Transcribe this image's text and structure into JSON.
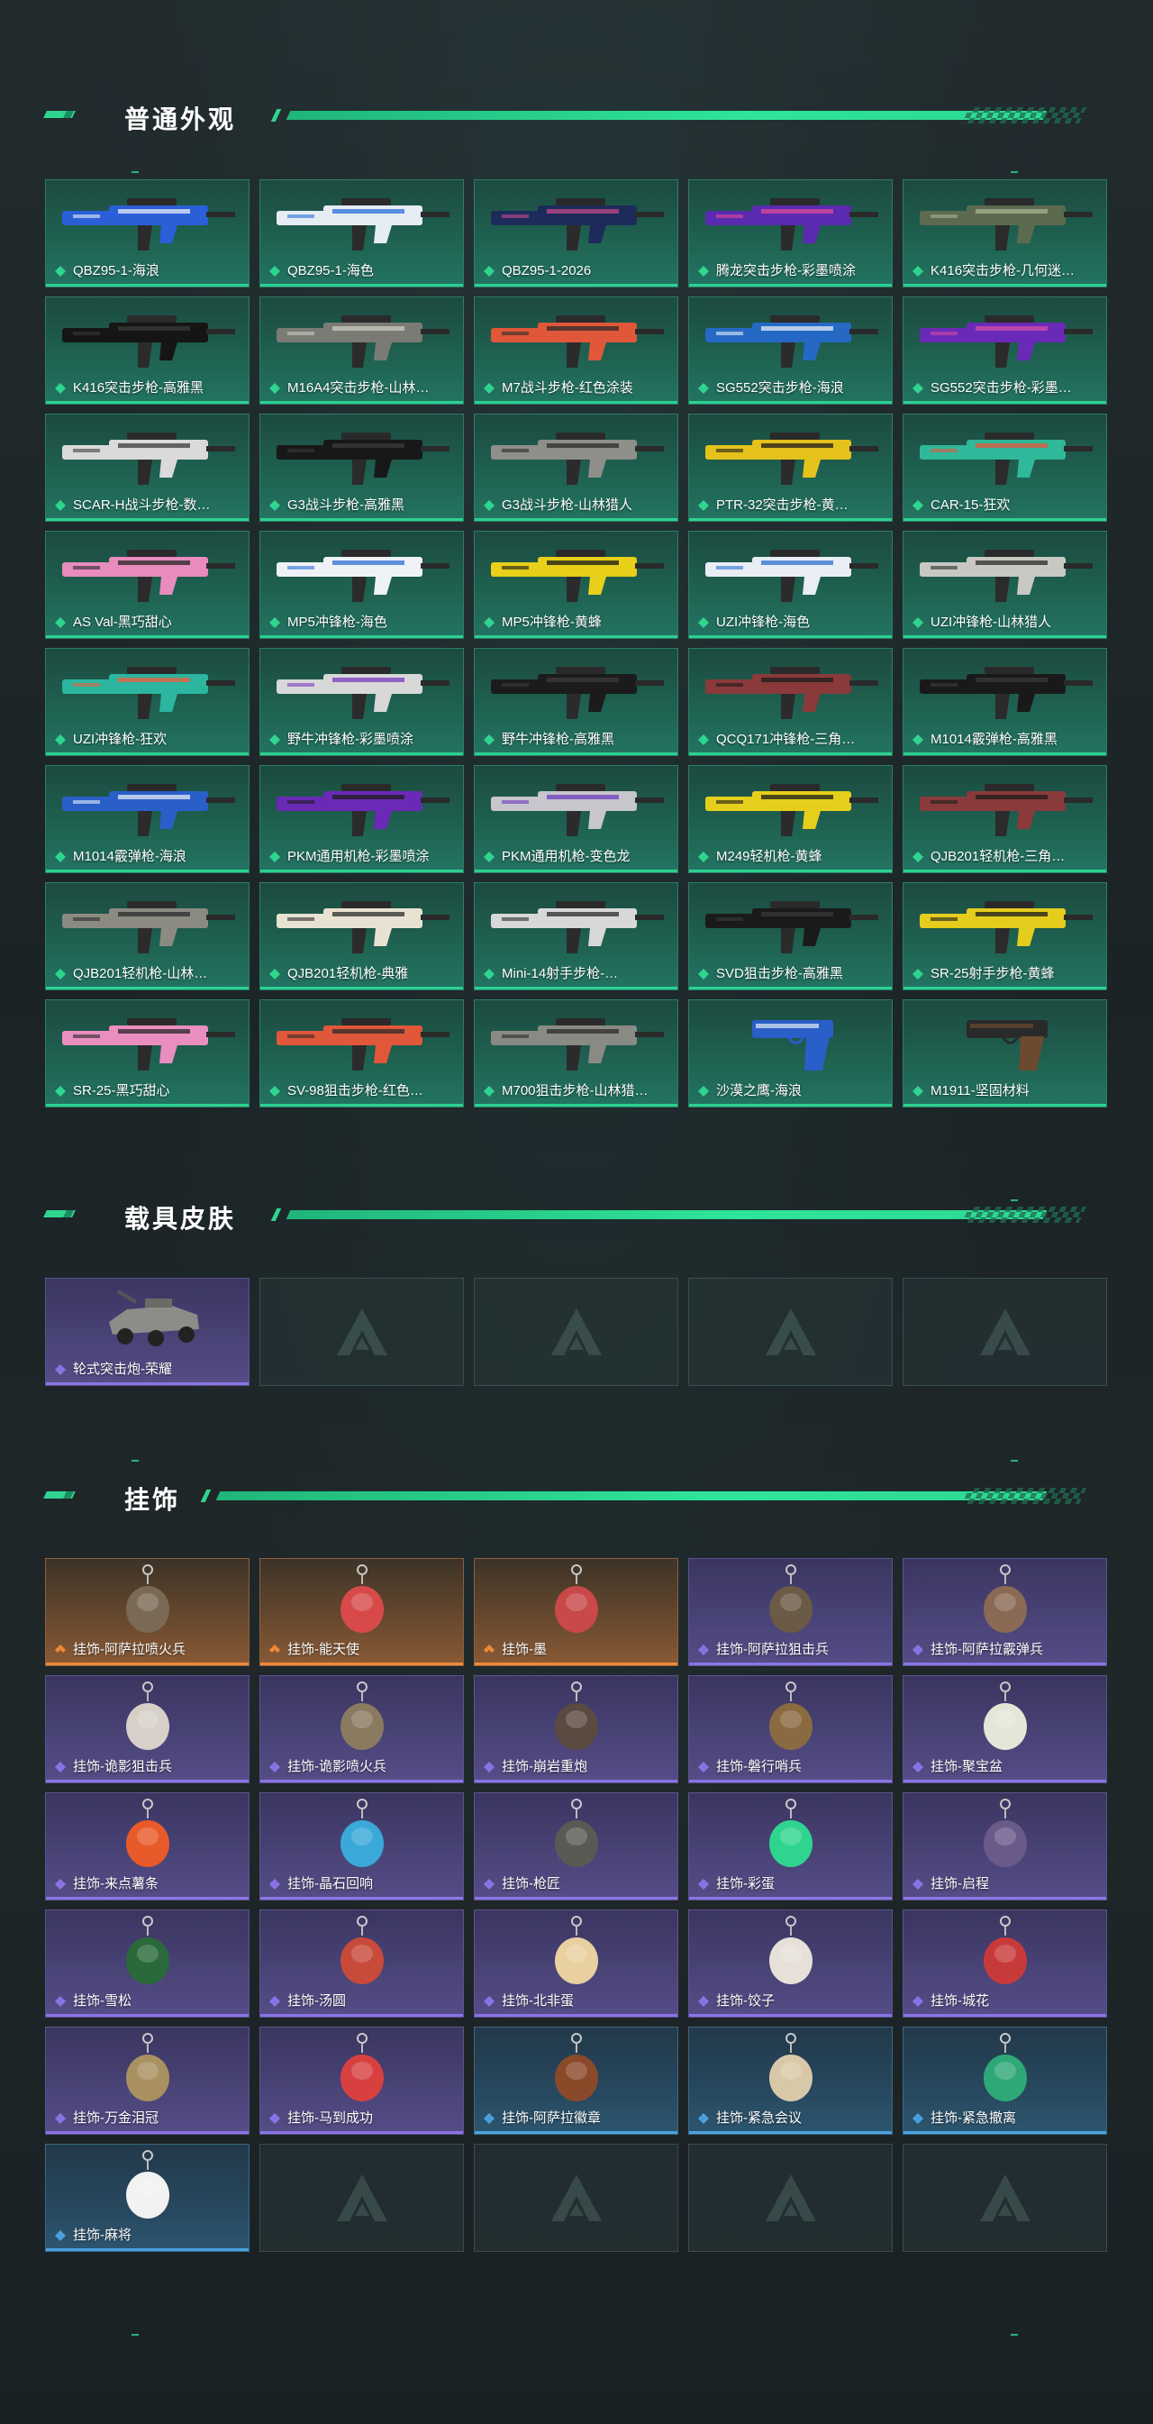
{
  "sections": {
    "weapons": {
      "title": "普通外观",
      "items": [
        {
          "label": "QBZ95-1-海浪",
          "color": "#2a5fd8",
          "accent": "#e9eef5"
        },
        {
          "label": "QBZ95-1-海色",
          "color": "#e6ecf3",
          "accent": "#2a6fd8"
        },
        {
          "label": "QBZ95-1-2026",
          "color": "#1d2b5a",
          "accent": "#c24b8a"
        },
        {
          "label": "腾龙突击步枪-彩墨喷涂",
          "color": "#5a2ab0",
          "accent": "#e04c9a"
        },
        {
          "label": "K416突击步枪-几何迷…",
          "color": "#5c6a50",
          "accent": "#a9b38e"
        },
        {
          "label": "K416突击步枪-高雅黑",
          "color": "#151515",
          "accent": "#3a3a3a"
        },
        {
          "label": "M16A4突击步枪-山林…",
          "color": "#7b7b76",
          "accent": "#c9c9c2"
        },
        {
          "label": "M7战斗步枪-红色涂装",
          "color": "#e0573a",
          "accent": "#2b2b2b"
        },
        {
          "label": "SG552突击步枪-海浪",
          "color": "#2569c4",
          "accent": "#e3eef8"
        },
        {
          "label": "SG552突击步枪-彩墨…",
          "color": "#6a2ab8",
          "accent": "#d54fa8"
        },
        {
          "label": "SCAR-H战斗步枪-数…",
          "color": "#dadada",
          "accent": "#3a3a3a"
        },
        {
          "label": "G3战斗步枪-高雅黑",
          "color": "#181818",
          "accent": "#3b3b3b"
        },
        {
          "label": "G3战斗步枪-山林猎人",
          "color": "#8e8e8a",
          "accent": "#2a2a2a"
        },
        {
          "label": "PTR-32突击步枪-黄…",
          "color": "#e5c21c",
          "accent": "#1a1a1a"
        },
        {
          "label": "CAR-15-狂欢",
          "color": "#2fb89a",
          "accent": "#e9553a"
        },
        {
          "label": "AS Val-黑巧甜心",
          "color": "#e88bbd",
          "accent": "#262626"
        },
        {
          "label": "MP5冲锋枪-海色",
          "color": "#eef2f7",
          "accent": "#2c6fd2"
        },
        {
          "label": "MP5冲锋枪-黄蜂",
          "color": "#e8cf1a",
          "accent": "#161616"
        },
        {
          "label": "UZI冲锋枪-海色",
          "color": "#e9eef5",
          "accent": "#2c6fd2"
        },
        {
          "label": "UZI冲锋枪-山林猎人",
          "color": "#c8c8c2",
          "accent": "#2a2a2a"
        },
        {
          "label": "UZI冲锋枪-狂欢",
          "color": "#2cb6a0",
          "accent": "#ef5d3c"
        },
        {
          "label": "野牛冲锋枪-彩墨喷涂",
          "color": "#d8d8d8",
          "accent": "#7a3ac2"
        },
        {
          "label": "野牛冲锋枪-高雅黑",
          "color": "#1b1b1b",
          "accent": "#3c3c3c"
        },
        {
          "label": "QCQ171冲锋枪-三角…",
          "color": "#8a3a3a",
          "accent": "#1c1c1c"
        },
        {
          "label": "M1014霰弹枪-高雅黑",
          "color": "#191919",
          "accent": "#3a3a3a"
        },
        {
          "label": "M1014霰弹枪-海浪",
          "color": "#2a5ec8",
          "accent": "#e6eef8"
        },
        {
          "label": "PKM通用机枪-彩墨喷涂",
          "color": "#6a2ab6",
          "accent": "#1c1c1c"
        },
        {
          "label": "PKM通用机枪-变色龙",
          "color": "#c6c6cc",
          "accent": "#6b3bc0"
        },
        {
          "label": "M249轻机枪-黄蜂",
          "color": "#e6cf1c",
          "accent": "#181818"
        },
        {
          "label": "QJB201轻机枪-三角…",
          "color": "#8a3a3a",
          "accent": "#1c1c1c"
        },
        {
          "label": "QJB201轻机枪-山林…",
          "color": "#8b8b82",
          "accent": "#2a2a2a"
        },
        {
          "label": "QJB201轻机枪-典雅",
          "color": "#e8e2d2",
          "accent": "#2a2a2a"
        },
        {
          "label": "Mini-14射手步枪-…",
          "color": "#d8d8d8",
          "accent": "#2a2a2a"
        },
        {
          "label": "SVD狙击步枪-高雅黑",
          "color": "#1a1a1a",
          "accent": "#3a3a3a"
        },
        {
          "label": "SR-25射手步枪-黄蜂",
          "color": "#e4cd1c",
          "accent": "#181818"
        },
        {
          "label": "SR-25-黑巧甜心",
          "color": "#ea8ec0",
          "accent": "#262626"
        },
        {
          "label": "SV-98狙击步枪-红色…",
          "color": "#e0573a",
          "accent": "#2b2b2b"
        },
        {
          "label": "M700狙击步枪-山林猎…",
          "color": "#8a8a84",
          "accent": "#2a2a2a"
        },
        {
          "label": "沙漠之鹰-海浪",
          "color": "#2a5ec8",
          "accent": "#e6eef8"
        },
        {
          "label": "M1911-坚固材料",
          "color": "#2a2a2a",
          "accent": "#6b4a30"
        }
      ]
    },
    "vehicles": {
      "title": "载具皮肤",
      "items": [
        {
          "label": "轮式突击炮-荣耀",
          "rarity": "purple"
        }
      ]
    },
    "charms": {
      "title": "挂饰",
      "items": [
        {
          "label": "挂饰-阿萨拉喷火兵",
          "rarity": "orange",
          "color": "#7a6a55"
        },
        {
          "label": "挂饰-能天使",
          "rarity": "orange",
          "color": "#d84a4a"
        },
        {
          "label": "挂饰-墨",
          "rarity": "orange",
          "color": "#c94848"
        },
        {
          "label": "挂饰-阿萨拉狙击兵",
          "rarity": "purple",
          "color": "#6b5a45"
        },
        {
          "label": "挂饰-阿萨拉霰弹兵",
          "rarity": "purple",
          "color": "#8a6a55"
        },
        {
          "label": "挂饰-诡影狙击兵",
          "rarity": "purple",
          "color": "#d6d0c8"
        },
        {
          "label": "挂饰-诡影喷火兵",
          "rarity": "purple",
          "color": "#8a7a60"
        },
        {
          "label": "挂饰-崩岩重炮",
          "rarity": "purple",
          "color": "#5a4a40"
        },
        {
          "label": "挂饰-磐行哨兵",
          "rarity": "purple",
          "color": "#8a6a40"
        },
        {
          "label": "挂饰-聚宝盆",
          "rarity": "purple",
          "color": "#e6e6d8"
        },
        {
          "label": "挂饰-来点薯条",
          "rarity": "purple",
          "color": "#e85a2a"
        },
        {
          "label": "挂饰-晶石回响",
          "rarity": "purple",
          "color": "#3aa8d8"
        },
        {
          "label": "挂饰-枪匠",
          "rarity": "purple",
          "color": "#5a5a55"
        },
        {
          "label": "挂饰-彩蛋",
          "rarity": "purple",
          "color": "#2fd58f"
        },
        {
          "label": "挂饰-启程",
          "rarity": "purple",
          "color": "#6a5a8a"
        },
        {
          "label": "挂饰-雪松",
          "rarity": "purple",
          "color": "#2a6a3a"
        },
        {
          "label": "挂饰-汤圆",
          "rarity": "purple",
          "color": "#c84a3a"
        },
        {
          "label": "挂饰-北非蛋",
          "rarity": "purple",
          "color": "#e8d0a0"
        },
        {
          "label": "挂饰-饺子",
          "rarity": "purple",
          "color": "#e6e0d8"
        },
        {
          "label": "挂饰-城花",
          "rarity": "purple",
          "color": "#c83a3a"
        },
        {
          "label": "挂饰-万金泪冠",
          "rarity": "purple",
          "color": "#a89060"
        },
        {
          "label": "挂饰-马到成功",
          "rarity": "purple",
          "color": "#d84040"
        },
        {
          "label": "挂饰-阿萨拉徽章",
          "rarity": "blue",
          "color": "#8a4a2a"
        },
        {
          "label": "挂饰-紧急会议",
          "rarity": "blue",
          "color": "#d8c8a8"
        },
        {
          "label": "挂饰-紧急撤离",
          "rarity": "blue",
          "color": "#2fa878"
        },
        {
          "label": "挂饰-麻将",
          "rarity": "blue",
          "color": "#f2f2f2"
        }
      ]
    }
  },
  "colors": {
    "accent_green": "#2fd58f",
    "rarity_purple": "#8b74e6",
    "rarity_orange": "#f08a37",
    "rarity_blue": "#4aa2e0"
  }
}
